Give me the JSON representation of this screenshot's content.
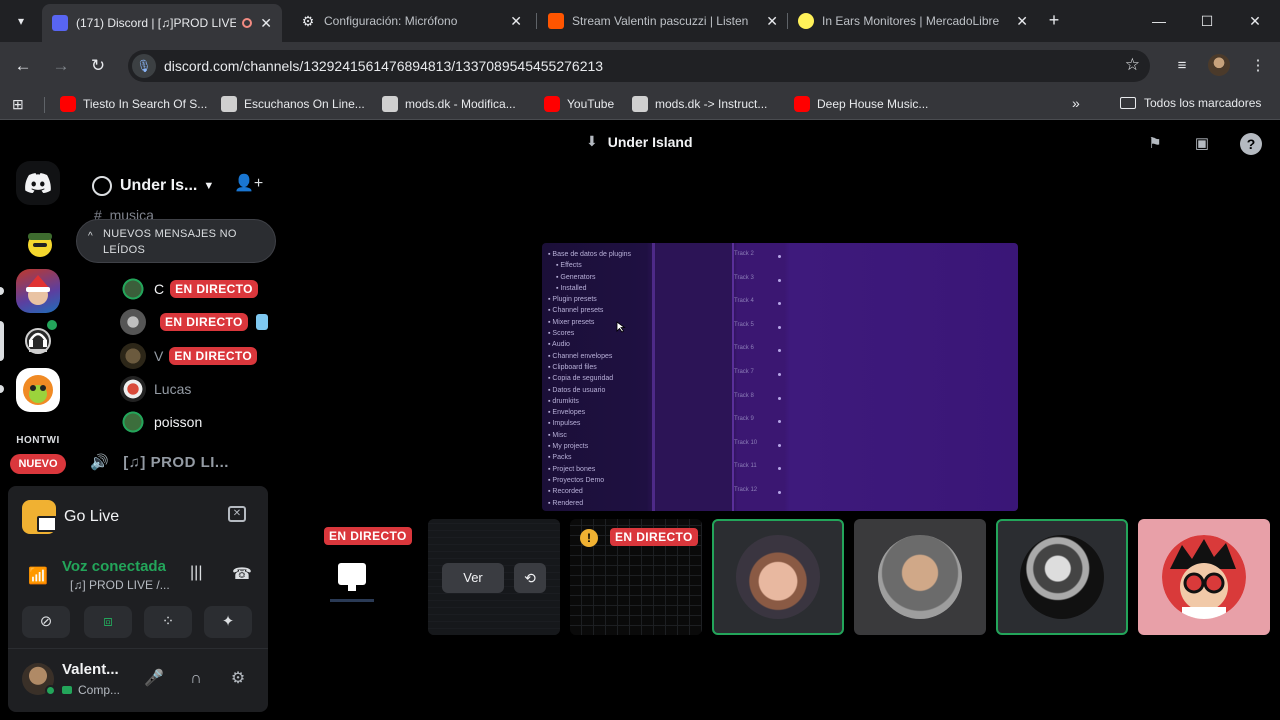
{
  "browser": {
    "tabs": [
      {
        "title": "(171) Discord | [♫]PROD LIVE",
        "active": true,
        "favicon_color": "#5865f2"
      },
      {
        "title": "Configuración: Micrófono",
        "active": false,
        "favicon_color": "#9aa0a6"
      },
      {
        "title": "Stream Valentin pascuzzi | Listen",
        "active": false,
        "favicon_color": "#ff5500"
      },
      {
        "title": "In Ears Monitores | MercadoLibre",
        "active": false,
        "favicon_color": "#fff159"
      }
    ],
    "url": "discord.com/channels/1329241561476894813/1337089545455276213",
    "bookmarks": [
      {
        "label": "Tiesto In Search Of S...",
        "icon": "youtube-icon",
        "color": "#ff0000"
      },
      {
        "label": "Escuchanos On Line...",
        "icon": "site-icon",
        "color": "#cfcfcf"
      },
      {
        "label": "mods.dk - Modifica...",
        "icon": "mods-icon",
        "color": "#d0d0d0"
      },
      {
        "label": "YouTube",
        "icon": "youtube-icon",
        "color": "#ff0000"
      },
      {
        "label": "mods.dk -> Instruct...",
        "icon": "mods-icon",
        "color": "#d0d0d0"
      },
      {
        "label": "Deep House Music...",
        "icon": "youtube-icon",
        "color": "#ff0000"
      }
    ],
    "bookmarks_folder": "Todos los marcadores"
  },
  "guilds": {
    "text_label": "HONTWI",
    "new_badge": "NUEVO"
  },
  "server": {
    "name": "Under Is...",
    "channel_hash_text": "musica",
    "unread_banner": "NUEVOS MENSAJES NO LEÍDOS",
    "voice_users": [
      {
        "name": "C",
        "live": true,
        "live_label": "EN DIRECTO",
        "highlight": true
      },
      {
        "name": "",
        "live": true,
        "live_label": "EN DIRECTO",
        "highlight": false
      },
      {
        "name": "V",
        "live": true,
        "live_label": "EN DIRECTO",
        "highlight": false
      },
      {
        "name": "Lucas",
        "live": false,
        "live_label": "",
        "highlight": false
      },
      {
        "name": "poisson",
        "live": false,
        "live_label": "",
        "highlight": true
      }
    ],
    "voice_channel": "[♫] PROD LI..."
  },
  "panel": {
    "go_live": "Go Live",
    "voice_status": "Voz conectada",
    "voice_channel": "[♫] PROD LIVE /...",
    "user_name": "Valent...",
    "user_status": "Comp..."
  },
  "stage": {
    "title": "Under Island",
    "daw_items": [
      "Base de datos de plugins",
      "Effects",
      "Generators",
      "Installed",
      "Plugin presets",
      "Channel presets",
      "Mixer presets",
      "Scores",
      "Audio",
      "Channel envelopes",
      "Clipboard files",
      "Copia de seguridad",
      "Datos de usuario",
      "drumkits",
      "Envelopes",
      "Impulses",
      "Misc",
      "My projects",
      "Packs",
      "Project bones",
      "Proyectos Demo",
      "Recorded",
      "Rendered"
    ],
    "daw_tracks": [
      "Track 2",
      "Track 3",
      "Track 4",
      "Track 5",
      "Track 6",
      "Track 7",
      "Track 8",
      "Track 9",
      "Track 10",
      "Track 11",
      "Track 12"
    ],
    "tile_live_label": "EN DIRECTO",
    "watch_label": "Ver"
  },
  "colors": {
    "accent_green": "#23a55a",
    "live_red": "#da373c",
    "blurple": "#5865f2"
  }
}
